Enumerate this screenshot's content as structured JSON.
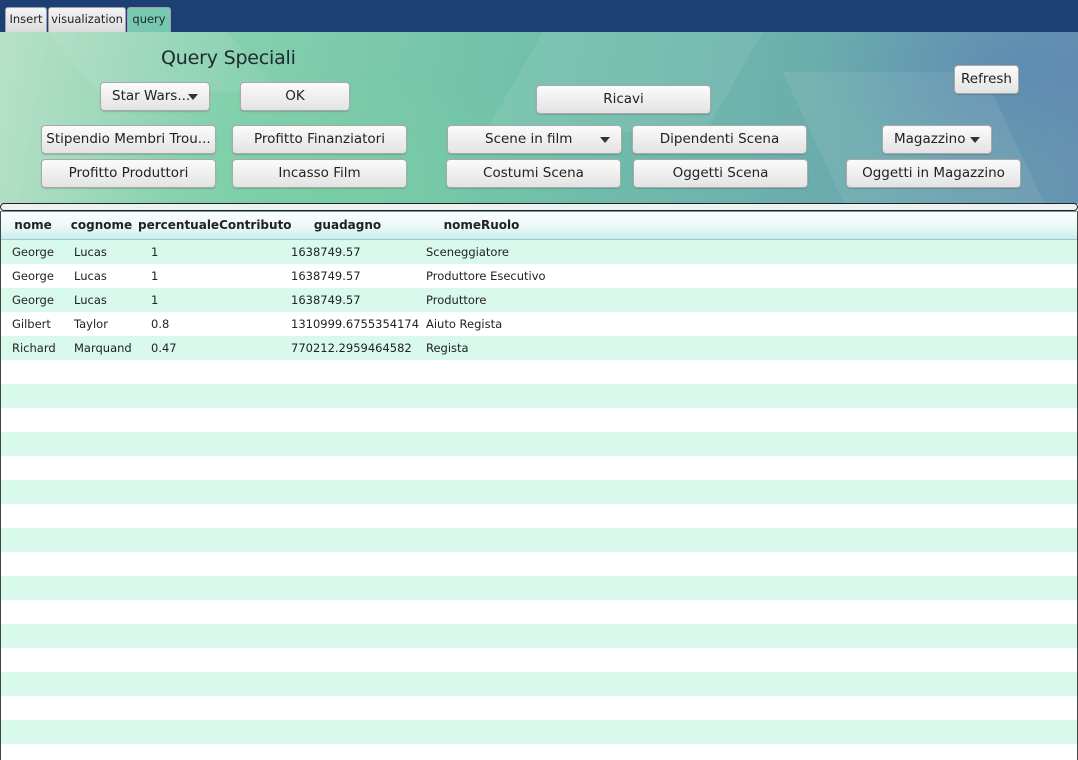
{
  "tabs": [
    {
      "label": "Insert",
      "active": false
    },
    {
      "label": "visualization",
      "active": false
    },
    {
      "label": "query",
      "active": true
    }
  ],
  "header": {
    "title": "Query Speciali",
    "film_combo": {
      "selected": "Star Wars..."
    },
    "ok_label": "OK",
    "ricavi_label": "Ricavi",
    "refresh_label": "Refresh",
    "stipendio_label": "Stipendio Membri Trou...",
    "profitto_finanziatori_label": "Profitto Finanziatori",
    "scene_combo": {
      "selected": "Scene in film"
    },
    "dipendenti_label": "Dipendenti Scena",
    "magazzino_combo": {
      "selected": "Magazzino"
    },
    "profitto_produttori_label": "Profitto Produttori",
    "incasso_label": "Incasso Film",
    "costumi_label": "Costumi Scena",
    "oggetti_scena_label": "Oggetti Scena",
    "oggetti_magazzino_label": "Oggetti in Magazzino"
  },
  "table": {
    "columns": [
      "nome",
      "cognome",
      "percentualeContributo",
      "guadagno",
      "nomeRuolo"
    ],
    "rows": [
      [
        "George",
        "Lucas",
        "1",
        "1638749.57",
        "Sceneggiatore"
      ],
      [
        "George",
        "Lucas",
        "1",
        "1638749.57",
        "Produttore Esecutivo"
      ],
      [
        "George",
        "Lucas",
        "1",
        "1638749.57",
        "Produttore"
      ],
      [
        "Gilbert",
        "Taylor",
        "0.8",
        "1310999.6755354174",
        "Aiuto Regista"
      ],
      [
        "Richard",
        "Marquand",
        "0.47",
        "770212.2959464582",
        "Regista"
      ]
    ]
  }
}
